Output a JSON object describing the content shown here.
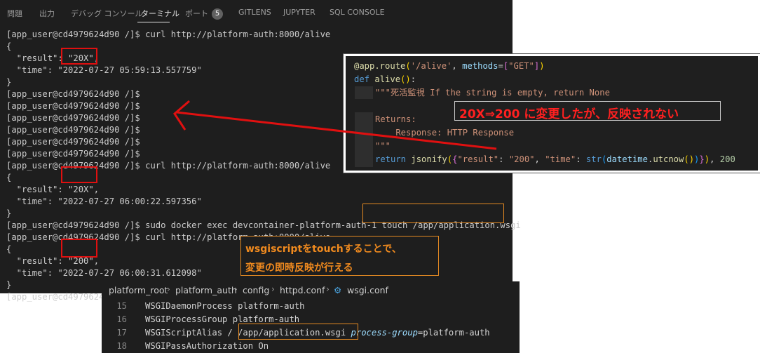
{
  "tabs": [
    {
      "label": "問題"
    },
    {
      "label": "出力"
    },
    {
      "label": "デバッグ コンソール"
    },
    {
      "label": "ターミナル"
    },
    {
      "label": "ポート"
    },
    {
      "label": "GITLENS"
    },
    {
      "label": "JUPYTER"
    },
    {
      "label": "SQL CONSOLE"
    }
  ],
  "ports_count": "5",
  "terminal_lines": [
    "[app_user@cd4979624d90 /]$ curl http://platform-auth:8000/alive",
    "{",
    "  \"result\": \"20X\",",
    "  \"time\": \"2022-07-27 05:59:13.557759\"",
    "}",
    "[app_user@cd4979624d90 /]$",
    "[app_user@cd4979624d90 /]$",
    "[app_user@cd4979624d90 /]$",
    "[app_user@cd4979624d90 /]$",
    "[app_user@cd4979624d90 /]$",
    "[app_user@cd4979624d90 /]$",
    "[app_user@cd4979624d90 /]$ curl http://platform-auth:8000/alive",
    "{",
    "  \"result\": \"20X\",",
    "  \"time\": \"2022-07-27 06:00:22.597356\"",
    "}",
    "[app_user@cd4979624d90 /]$ sudo docker exec devcontainer-platform-auth-1 touch /app/application.wsgi",
    "[app_user@cd4979624d90 /]$ curl http://platform-auth:8000/alive",
    "{",
    "  \"result\": \"200\",",
    "  \"time\": \"2022-07-27 06:00:31.612098\"",
    "}",
    "[app_user@cd4979624"
  ],
  "code": {
    "decorator": "@app.route",
    "route_path": "'/alive'",
    "methods_kw": "methods",
    "methods_val": "\"GET\"",
    "def_kw": "def",
    "func_name": "alive",
    "doc_line1": "\"\"\"死活監視 If the string is empty, return None",
    "doc_line2": "Returns:",
    "doc_line3": "    Response: HTTP Response",
    "doc_line4": "\"\"\"",
    "return_kw": "return",
    "jsonify": "jsonify",
    "key_result": "\"result\"",
    "val_200": "\"200\"",
    "key_time": "\"time\"",
    "str_fn": "str",
    "datetime": "datetime",
    "utcnow": "utcnow",
    "status": "200"
  },
  "annotations": {
    "not_reflected": "20X⇒200 に変更したが、反映されない",
    "touch_line1": "wsgiscriptをtouchすることで、",
    "touch_line2": "変更の即時反映が行える"
  },
  "breadcrumb": [
    "platform_root",
    "platform_auth",
    "config",
    "httpd.conf",
    "wsgi.conf"
  ],
  "editor_lines": [
    {
      "num": "15",
      "text": "WSGIDaemonProcess platform-auth"
    },
    {
      "num": "16",
      "text": "WSGIProcessGroup platform-auth"
    },
    {
      "num": "17",
      "pre": "WSGIScriptAlias / ",
      "path": "/app/application.wsgi",
      "post_kw": "process-group",
      "post_val": "=platform-auth"
    },
    {
      "num": "18",
      "text": "WSGIPassAuthorization On"
    }
  ],
  "colors": {
    "annotation_red": "#e01010",
    "annotation_orange": "#e58a22",
    "terminal_bg": "#1e1e1e"
  }
}
